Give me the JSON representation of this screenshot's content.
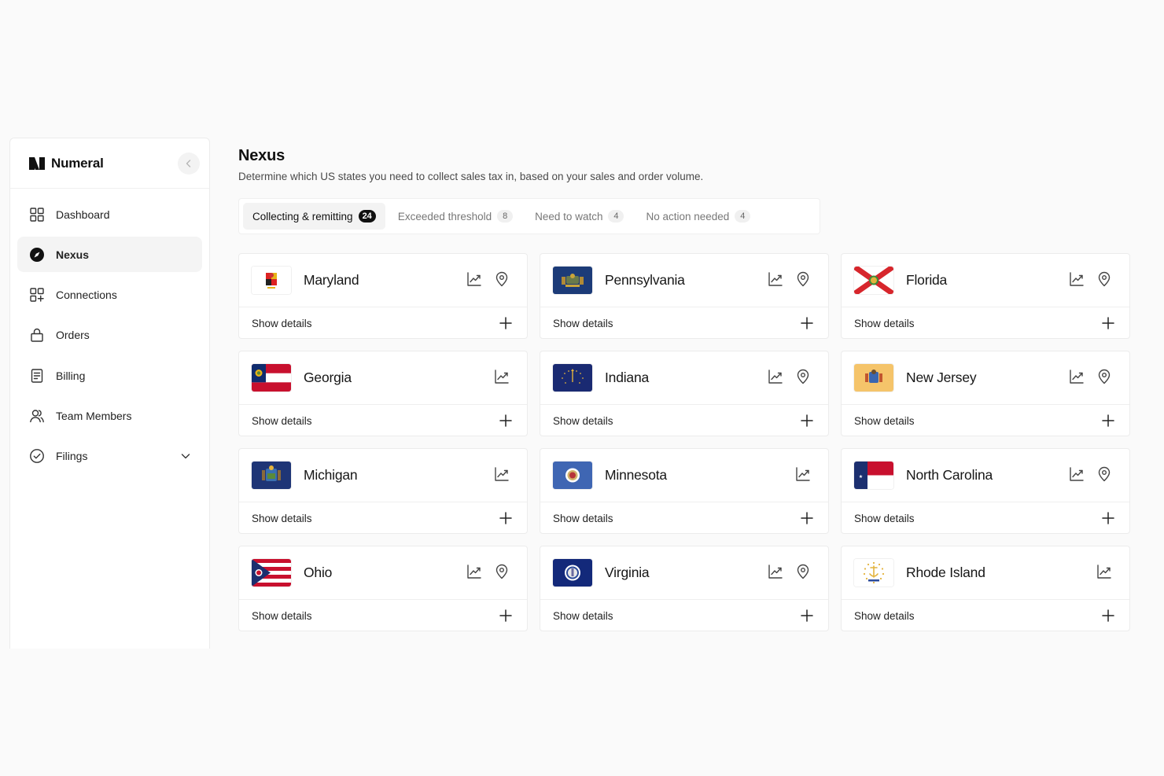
{
  "app": {
    "brand": "Numeral"
  },
  "sidebar": {
    "items": [
      {
        "label": "Dashboard",
        "icon": "grid-icon",
        "active": false
      },
      {
        "label": "Nexus",
        "icon": "compass-icon",
        "active": true
      },
      {
        "label": "Connections",
        "icon": "connections-icon",
        "active": false
      },
      {
        "label": "Orders",
        "icon": "lock-bag-icon",
        "active": false
      },
      {
        "label": "Billing",
        "icon": "document-icon",
        "active": false
      },
      {
        "label": "Team Members",
        "icon": "users-icon",
        "active": false
      },
      {
        "label": "Filings",
        "icon": "check-circle-icon",
        "active": false,
        "expandable": true
      }
    ]
  },
  "page": {
    "title": "Nexus",
    "subtitle": "Determine which US states you need to collect sales tax in, based on your sales and order volume."
  },
  "tabs": [
    {
      "label": "Collecting & remitting",
      "count": "24",
      "active": true
    },
    {
      "label": "Exceeded threshold",
      "count": "8",
      "active": false
    },
    {
      "label": "Need to watch",
      "count": "4",
      "active": false
    },
    {
      "label": "No action needed",
      "count": "4",
      "active": false
    }
  ],
  "card_action_label": "Show details",
  "states": [
    {
      "name": "Maryland",
      "flag": "maryland",
      "icons": [
        "chart-icon",
        "location-pin-icon"
      ]
    },
    {
      "name": "Pennsylvania",
      "flag": "pennsylvania",
      "icons": [
        "chart-icon",
        "location-pin-icon"
      ]
    },
    {
      "name": "Florida",
      "flag": "florida",
      "icons": [
        "chart-icon",
        "location-pin-icon"
      ]
    },
    {
      "name": "Georgia",
      "flag": "georgia",
      "icons": [
        "chart-icon"
      ]
    },
    {
      "name": "Indiana",
      "flag": "indiana",
      "icons": [
        "chart-icon",
        "location-pin-icon"
      ]
    },
    {
      "name": "New Jersey",
      "flag": "new-jersey",
      "icons": [
        "chart-icon",
        "location-pin-icon"
      ]
    },
    {
      "name": "Michigan",
      "flag": "michigan",
      "icons": [
        "chart-icon"
      ]
    },
    {
      "name": "Minnesota",
      "flag": "minnesota",
      "icons": [
        "chart-icon"
      ]
    },
    {
      "name": "North Carolina",
      "flag": "north-carolina",
      "icons": [
        "chart-icon",
        "location-pin-icon"
      ]
    },
    {
      "name": "Ohio",
      "flag": "ohio",
      "icons": [
        "chart-icon",
        "location-pin-icon"
      ]
    },
    {
      "name": "Virginia",
      "flag": "virginia",
      "icons": [
        "chart-icon",
        "location-pin-icon"
      ]
    },
    {
      "name": "Rhode Island",
      "flag": "rhode-island",
      "icons": [
        "chart-icon"
      ]
    }
  ],
  "colors": {
    "accent": "#111111",
    "muted_text": "#777777",
    "border": "#ececec",
    "background": "#fafafa"
  }
}
